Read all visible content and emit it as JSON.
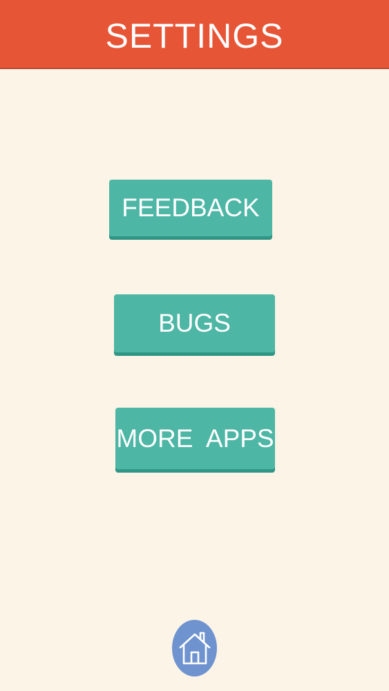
{
  "header": {
    "title": "SETTINGS",
    "background_color": "#e75537"
  },
  "menu": {
    "feedback_label": "FEEDBACK",
    "bugs_label": "BUGS",
    "more_apps_label": "MORE  APPS",
    "button_color": "#4db6a5"
  },
  "home": {
    "icon": "home-icon",
    "color": "#6f93cf"
  }
}
